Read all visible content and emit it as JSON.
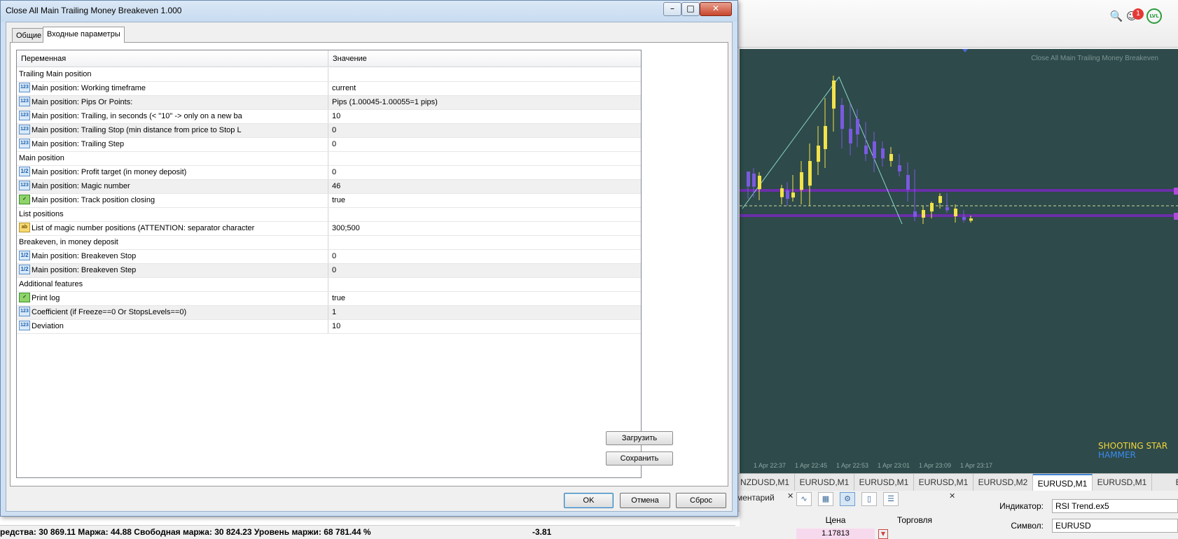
{
  "dialog": {
    "title": "Close All Main Trailing Money Breakeven 1.000",
    "tabs": [
      {
        "label": "Общие",
        "active": false
      },
      {
        "label": "Входные параметры",
        "active": true
      }
    ],
    "table": {
      "headers": {
        "variable": "Переменная",
        "value": "Значение"
      },
      "rows": [
        {
          "kind": "group",
          "name": "Trailing Main position",
          "value": ""
        },
        {
          "kind": "int",
          "name": "Main position: Working timeframe",
          "value": "current"
        },
        {
          "kind": "int",
          "name": "Main position: Pips Or Points:",
          "value": "Pips (1.00045-1.00055=1 pips)"
        },
        {
          "kind": "int",
          "name": "Main position: Trailing, in seconds (< \"10\" -> only on a new ba",
          "value": "10"
        },
        {
          "kind": "int",
          "name": "Main position: Trailing Stop (min distance from price to Stop L",
          "value": "0"
        },
        {
          "kind": "int",
          "name": "Main position: Trailing Step",
          "value": "0"
        },
        {
          "kind": "group",
          "name": "Main position",
          "value": ""
        },
        {
          "kind": "double",
          "name": "Main position: Profit target (in money deposit)",
          "value": "0"
        },
        {
          "kind": "int",
          "name": "Main position: Magic number",
          "value": "46"
        },
        {
          "kind": "bool",
          "name": "Main position: Track position closing",
          "value": "true"
        },
        {
          "kind": "group",
          "name": "List positions",
          "value": ""
        },
        {
          "kind": "string",
          "name": "List of magic number positions (ATTENTION: separator character",
          "value": "300;500"
        },
        {
          "kind": "group",
          "name": "Breakeven, in money deposit",
          "value": ""
        },
        {
          "kind": "double",
          "name": "Main position: Breakeven Stop",
          "value": "0"
        },
        {
          "kind": "double",
          "name": "Main position: Breakeven Step",
          "value": "0"
        },
        {
          "kind": "group",
          "name": "Additional features",
          "value": ""
        },
        {
          "kind": "bool",
          "name": "Print log",
          "value": "true"
        },
        {
          "kind": "int",
          "name": "Coefficient (if Freeze==0 Or StopsLevels==0)",
          "value": "1"
        },
        {
          "kind": "int",
          "name": "Deviation",
          "value": "10"
        }
      ]
    },
    "icon_text": {
      "int": "123",
      "double": "1/2",
      "bool": "✓",
      "string": "ab"
    },
    "side_buttons": {
      "load": "Загрузить",
      "save": "Сохранить"
    },
    "footer_buttons": {
      "ok": "OK",
      "cancel": "Отмена",
      "reset": "Сброс"
    },
    "window_buttons": {
      "minimize": "–",
      "maximize": "□",
      "close": "✕"
    }
  },
  "terminal": {
    "chart": {
      "indicator_label": "Close All Main Trailing Money Breakeven",
      "pattern_labels": {
        "shooting_star": "SHOOTING STAR",
        "hammer": "HAMMER"
      },
      "time_ticks": [
        "1 Apr 22:37",
        "1 Apr 22:45",
        "1 Apr 22:53",
        "1 Apr 23:01",
        "1 Apr 23:09",
        "1 Apr 23:17"
      ],
      "colors": {
        "background": "#2e4a4a",
        "bull_candle": "#f3e34a",
        "bear_candle": "#7a5ae0",
        "level_line": "#6a2fa8",
        "zigzag": "#8ad6c8",
        "shooting_star": "#f3d63a",
        "hammer": "#3a8bf0"
      }
    },
    "chart_tabs": [
      {
        "label": "NZDUSD,M1",
        "active": false
      },
      {
        "label": "EURUSD,M1",
        "active": false
      },
      {
        "label": "EURUSD,M1",
        "active": false
      },
      {
        "label": "EURUSD,M1",
        "active": false
      },
      {
        "label": "EURUSD,M2",
        "active": false
      },
      {
        "label": "EURUSD,M1",
        "active": true
      },
      {
        "label": "EURUSD,M1",
        "active": false
      },
      {
        "label": "EU",
        "active": false
      }
    ],
    "top_icons": [
      "search-icon",
      "user-icon",
      "lvl-icon"
    ],
    "notification_count": "1",
    "lvl_label": "LVL",
    "bottom": {
      "comment_tab": "ментарий",
      "close_glyph": "✕",
      "price_header": "Цена",
      "trade_header": "Торговля",
      "price_value": "1.17813",
      "indicator_label": "Индикатор:",
      "indicator_value": "RSI Trend.ex5",
      "symbol_label": "Символ:",
      "symbol_value": "EURUSD"
    },
    "status": {
      "text": "редства: 30 869.11  Маржа: 44.88  Свободная маржа: 30 824.23  Уровень маржи: 68 781.44 %",
      "profit": "-3.81"
    }
  }
}
